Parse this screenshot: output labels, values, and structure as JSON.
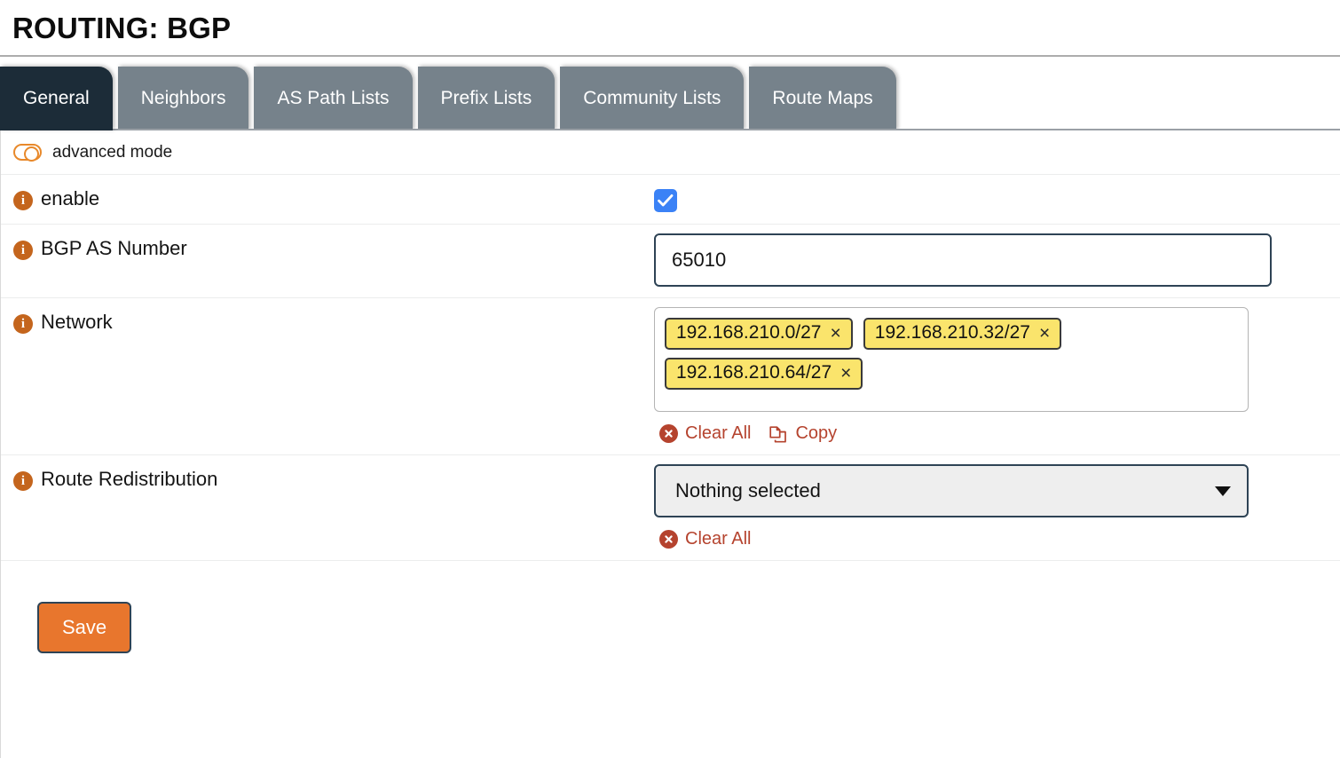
{
  "header": {
    "title": "ROUTING: BGP"
  },
  "tabs": [
    {
      "label": "General",
      "active": true
    },
    {
      "label": "Neighbors",
      "active": false
    },
    {
      "label": "AS Path Lists",
      "active": false
    },
    {
      "label": "Prefix Lists",
      "active": false
    },
    {
      "label": "Community Lists",
      "active": false
    },
    {
      "label": "Route Maps",
      "active": false
    }
  ],
  "advanced_mode": {
    "label": "advanced mode",
    "enabled": false,
    "toggle_icon": "toggle-off-icon",
    "accent_color": "#e8892b"
  },
  "form": {
    "enable": {
      "label": "enable",
      "info_icon": "info-icon",
      "checked": true,
      "checkbox_color": "#3b82f6"
    },
    "as_number": {
      "label": "BGP AS Number",
      "info_icon": "info-icon",
      "value": "65010",
      "placeholder": ""
    },
    "network": {
      "label": "Network",
      "info_icon": "info-icon",
      "tags": [
        "192.168.210.0/27",
        "192.168.210.32/27",
        "192.168.210.64/27"
      ],
      "tag_remove_glyph": "×",
      "tag_color": "#fae46c",
      "actions": [
        {
          "label": "Clear All",
          "icon": "clear-all-icon"
        },
        {
          "label": "Copy",
          "icon": "copy-icon"
        }
      ]
    },
    "route_redistribution": {
      "label": "Route Redistribution",
      "info_icon": "info-icon",
      "selected": "Nothing selected",
      "caret_icon": "chevron-down-icon",
      "actions": [
        {
          "label": "Clear All",
          "icon": "clear-all-icon"
        }
      ]
    }
  },
  "footer": {
    "save_label": "Save",
    "save_color": "#e8762d"
  }
}
